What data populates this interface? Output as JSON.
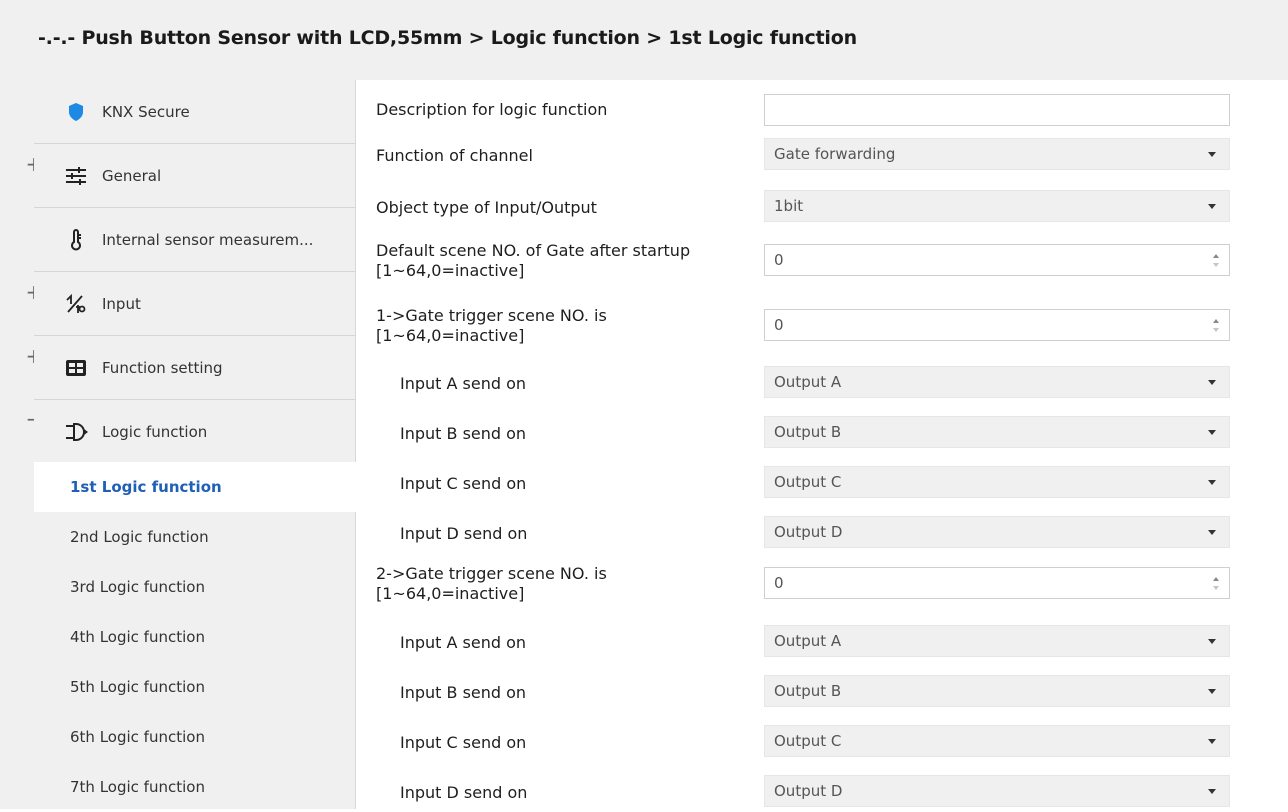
{
  "header": {
    "title": "-.-.- Push Button Sensor with LCD,55mm > Logic function > 1st Logic function"
  },
  "sidebar": {
    "items": [
      {
        "label": "KNX Secure",
        "icon": "shield-icon",
        "expander": ""
      },
      {
        "label": "General",
        "icon": "sliders-icon",
        "expander": "+"
      },
      {
        "label": "Internal sensor measurem...",
        "icon": "thermometer-icon",
        "expander": ""
      },
      {
        "label": "Input",
        "icon": "input-icon",
        "expander": "+"
      },
      {
        "label": "Function setting",
        "icon": "grid-icon",
        "expander": "+"
      },
      {
        "label": "Logic function",
        "icon": "logic-icon",
        "expander": "−"
      }
    ],
    "sub_items": [
      {
        "label": "1st Logic function",
        "active": true
      },
      {
        "label": "2nd Logic function",
        "active": false
      },
      {
        "label": "3rd Logic function",
        "active": false
      },
      {
        "label": "4th Logic function",
        "active": false
      },
      {
        "label": "5th Logic function",
        "active": false
      },
      {
        "label": "6th Logic function",
        "active": false
      },
      {
        "label": "7th Logic function",
        "active": false
      }
    ]
  },
  "params": [
    {
      "label": "Description for logic function",
      "type": "text",
      "value": ""
    },
    {
      "label": "Function of channel",
      "type": "select",
      "value": "Gate forwarding"
    },
    {
      "label": "Object type of Input/Output",
      "type": "select",
      "value": "1bit"
    },
    {
      "label": "Default scene NO. of Gate after startup",
      "label2": "[1~64,0=inactive]",
      "type": "spin",
      "value": "0"
    },
    {
      "label": "1->Gate trigger scene NO. is",
      "label2": "[1~64,0=inactive]",
      "type": "spin",
      "value": "0"
    },
    {
      "label": "Input A send on",
      "type": "select",
      "value": "Output A",
      "indent": true
    },
    {
      "label": "Input B send on",
      "type": "select",
      "value": "Output B",
      "indent": true
    },
    {
      "label": "Input C send on",
      "type": "select",
      "value": "Output C",
      "indent": true
    },
    {
      "label": "Input D send on",
      "type": "select",
      "value": "Output D",
      "indent": true
    },
    {
      "label": "2->Gate trigger scene NO. is",
      "label2": "[1~64,0=inactive]",
      "type": "spin",
      "value": "0"
    },
    {
      "label": "Input A send on",
      "type": "select",
      "value": "Output A",
      "indent": true
    },
    {
      "label": "Input B send on",
      "type": "select",
      "value": "Output B",
      "indent": true
    },
    {
      "label": "Input C send on",
      "type": "select",
      "value": "Output C",
      "indent": true
    },
    {
      "label": "Input D send on",
      "type": "select",
      "value": "Output D",
      "indent": true
    }
  ],
  "colors": {
    "active_link": "#1f5fb5",
    "shield": "#1e88e5"
  }
}
